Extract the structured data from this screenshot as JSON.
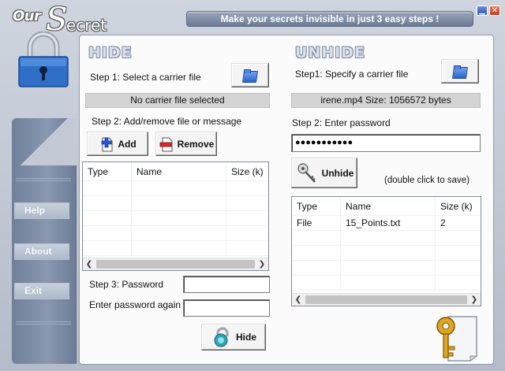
{
  "app": {
    "logo_our": "Our",
    "logo_s": "S",
    "logo_ecret": "ecret",
    "tagline": "Make your secrets invisible in just 3 easy steps !",
    "minimize_glyph": "▁",
    "close_glyph": "✕"
  },
  "sidebar": {
    "items": [
      {
        "label": "Help"
      },
      {
        "label": "About"
      },
      {
        "label": "Exit"
      }
    ]
  },
  "hide": {
    "title": "HIDE",
    "step1_label": "Step 1: Select a carrier file",
    "carrier_status": "No carrier file selected",
    "step2_label": "Step 2: Add/remove file or message",
    "add_label": "Add",
    "remove_label": "Remove",
    "columns": {
      "type": "Type",
      "name": "Name",
      "size": "Size (k)"
    },
    "rows": [],
    "step3_label": "Step 3: Password",
    "password_again_label": "Enter password again",
    "password_value": "",
    "password_again_value": "",
    "hide_button_label": "Hide"
  },
  "unhide": {
    "title": "UNHIDE",
    "step1_label": "Step1: Specify a carrier file",
    "carrier_status": "irene.mp4   Size: 1056572 bytes",
    "step2_label": "Step 2: Enter password",
    "password_value": "●●●●●●●●●●●",
    "unhide_button_label": "Unhide",
    "save_hint": "(double click to save)",
    "columns": {
      "type": "Type",
      "name": "Name",
      "size": "Size (k)"
    },
    "rows": [
      {
        "type": "File",
        "name": "15_Points.txt",
        "size": "2"
      }
    ]
  },
  "icons": {
    "folder": "folder-icon",
    "lock": "padlock-icon",
    "key": "key-icon",
    "add": "add-file-icon",
    "remove": "remove-file-icon",
    "hide": "lock-hide-icon",
    "unhide": "key-unhide-icon"
  },
  "colors": {
    "background": "#c3cad5",
    "panel": "#fbfbfb",
    "title_outline": "#7c8aa3",
    "rail": "#8091ad"
  }
}
